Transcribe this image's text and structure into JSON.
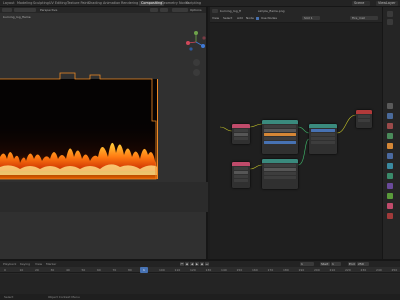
{
  "topbar": {
    "tabs": [
      "Layout",
      "Modeling",
      "Sculpting",
      "UV Editing",
      "Texture Paint",
      "Shading",
      "Animation",
      "Rendering",
      "Compositing",
      "Geometry Nodes",
      "Scripting"
    ],
    "active_tab": "Compositing",
    "scene_label": "Scene",
    "view_layer_label": "ViewLayer"
  },
  "viewport": {
    "header_text": "Perspective",
    "object_label": "burning_log_flame",
    "options_label": "Options"
  },
  "node_editor": {
    "image_name": "burning_log_fl",
    "image_file": "simple_flame.png",
    "menu_view": "View",
    "menu_select": "Select",
    "menu_add": "Add",
    "menu_node": "Node",
    "use_nodes_label": "Use Nodes",
    "slot_label": "Slot 1",
    "material_name": "Fire_mat"
  },
  "timeline": {
    "playback_label": "Playback",
    "keying_label": "Keying",
    "view_label": "View",
    "marker_label": "Marker",
    "current_frame": "1",
    "start_label": "Start",
    "start_value": "1",
    "end_label": "End",
    "end_value": "250",
    "ticks": [
      "0",
      "10",
      "20",
      "30",
      "40",
      "50",
      "60",
      "70",
      "80",
      "90",
      "100",
      "110",
      "120",
      "130",
      "140",
      "150",
      "160",
      "170",
      "180",
      "190",
      "200",
      "210",
      "220",
      "230",
      "240",
      "250"
    ]
  },
  "status": {
    "left_text": "Select",
    "mid_text": "Object Context Menu"
  },
  "colors": {
    "accent": "#4772b3",
    "orange_outline": "#f08a24",
    "node_image": "#c04b6b",
    "node_shader": "#3a8a7d",
    "node_output": "#b23a3a",
    "node_vector": "#5a3e8a"
  }
}
